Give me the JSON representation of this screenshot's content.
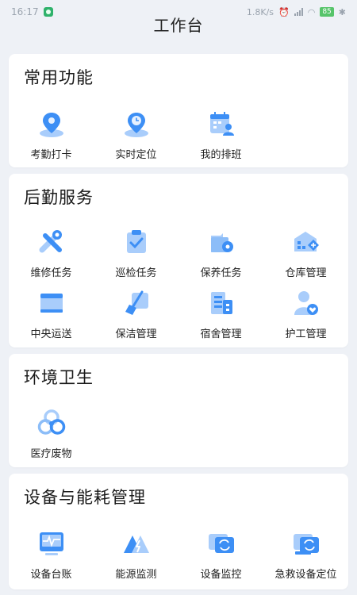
{
  "status_bar": {
    "time": "16:17",
    "net_speed": "1.8K/s",
    "battery": "85"
  },
  "header": {
    "title": "工作台"
  },
  "sections": [
    {
      "title": "常用功能",
      "items": [
        {
          "label": "考勤打卡",
          "icon": "location-pin-icon"
        },
        {
          "label": "实时定位",
          "icon": "clock-location-icon"
        },
        {
          "label": "我的排班",
          "icon": "calendar-person-icon"
        }
      ]
    },
    {
      "title": "后勤服务",
      "items": [
        {
          "label": "维修任务",
          "icon": "wrench-icon"
        },
        {
          "label": "巡检任务",
          "icon": "clipboard-check-icon"
        },
        {
          "label": "保养任务",
          "icon": "gear-box-icon"
        },
        {
          "label": "仓库管理",
          "icon": "warehouse-icon"
        },
        {
          "label": "中央运送",
          "icon": "box-icon"
        },
        {
          "label": "保洁管理",
          "icon": "broom-icon"
        },
        {
          "label": "宿舍管理",
          "icon": "building-icon"
        },
        {
          "label": "护工管理",
          "icon": "caregiver-icon"
        }
      ]
    },
    {
      "title": "环境卫生",
      "items": [
        {
          "label": "医疗废物",
          "icon": "biohazard-icon"
        }
      ]
    },
    {
      "title": "设备与能耗管理",
      "items": [
        {
          "label": "设备台账",
          "icon": "monitor-pulse-icon"
        },
        {
          "label": "能源监测",
          "icon": "energy-triangle-icon"
        },
        {
          "label": "设备监控",
          "icon": "device-sync-icon"
        },
        {
          "label": "急救设备定位",
          "icon": "emergency-device-icon"
        }
      ]
    }
  ],
  "colors": {
    "icon_primary": "#3d8ff5",
    "icon_light": "#a9cdfb",
    "background": "#eef1f6"
  }
}
